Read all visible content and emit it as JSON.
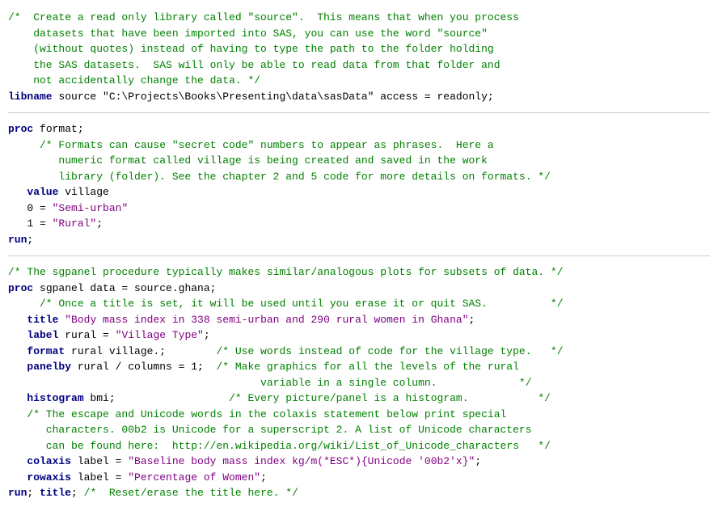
{
  "colors": {
    "comment": "#008000",
    "keyword": "#000080",
    "string": "#800080",
    "normal": "#000000",
    "red": "#cc0000"
  },
  "sections": [
    {
      "id": "libname-section",
      "lines": [
        {
          "type": "comment",
          "text": "/*  Create a read only library called \"source\".  This means that when you process"
        },
        {
          "type": "comment",
          "text": "    datasets that have been imported into SAS, you can use the word \"source\""
        },
        {
          "type": "comment",
          "text": "    (without quotes) instead of having to type the path to the folder holding"
        },
        {
          "type": "comment",
          "text": "    the SAS datasets.  SAS will only be able to read data from that folder and"
        },
        {
          "type": "comment",
          "text": "    not accidentally change the data. */"
        },
        {
          "type": "mixed",
          "parts": [
            {
              "style": "keyword",
              "text": "libname"
            },
            {
              "style": "normal",
              "text": " source \"C:\\Projects\\Books\\Presenting\\data\\sasData\" access = readonly;"
            }
          ]
        }
      ]
    },
    {
      "id": "format-section",
      "lines": [
        {
          "type": "mixed",
          "parts": [
            {
              "style": "keyword",
              "text": "proc"
            },
            {
              "style": "normal",
              "text": " format;"
            }
          ]
        },
        {
          "type": "comment",
          "text": "     /* Formats can cause \"secret code\" numbers to appear as phrases.  Here a"
        },
        {
          "type": "comment",
          "text": "        numeric format called village is being created and saved in the work"
        },
        {
          "type": "comment",
          "text": "        library (folder). See the chapter 2 and 5 code for more details on formats. */"
        },
        {
          "type": "mixed",
          "parts": [
            {
              "style": "normal",
              "text": "   "
            },
            {
              "style": "keyword",
              "text": "value"
            },
            {
              "style": "normal",
              "text": " village"
            }
          ]
        },
        {
          "type": "mixed",
          "parts": [
            {
              "style": "normal",
              "text": "   0 = "
            },
            {
              "style": "string",
              "text": "\"Semi-urban\""
            }
          ]
        },
        {
          "type": "mixed",
          "parts": [
            {
              "style": "normal",
              "text": "   1 = "
            },
            {
              "style": "string",
              "text": "\"Rural\""
            },
            {
              "style": "normal",
              "text": ";"
            }
          ]
        },
        {
          "type": "mixed",
          "parts": [
            {
              "style": "keyword",
              "text": "run"
            },
            {
              "style": "normal",
              "text": ";"
            }
          ]
        }
      ]
    },
    {
      "id": "sgpanel-section",
      "lines": [
        {
          "type": "comment",
          "text": "/* The sgpanel procedure typically makes similar/analogous plots for subsets of data. */"
        },
        {
          "type": "mixed",
          "parts": [
            {
              "style": "keyword",
              "text": "proc"
            },
            {
              "style": "normal",
              "text": " sgpanel data = source.ghana;"
            }
          ]
        },
        {
          "type": "comment",
          "text": "     /* Once a title is set, it will be used until you erase it or quit SAS.          */"
        },
        {
          "type": "mixed",
          "parts": [
            {
              "style": "normal",
              "text": "   "
            },
            {
              "style": "keyword",
              "text": "title"
            },
            {
              "style": "normal",
              "text": " "
            },
            {
              "style": "string",
              "text": "\"Body mass index in 338 semi-urban and 290 rural women in Ghana\""
            },
            {
              "style": "normal",
              "text": ";"
            }
          ]
        },
        {
          "type": "mixed",
          "parts": [
            {
              "style": "normal",
              "text": "   "
            },
            {
              "style": "keyword",
              "text": "label"
            },
            {
              "style": "normal",
              "text": " rural = "
            },
            {
              "style": "string",
              "text": "\"Village Type\""
            },
            {
              "style": "normal",
              "text": ";"
            }
          ]
        },
        {
          "type": "mixed",
          "parts": [
            {
              "style": "normal",
              "text": "   "
            },
            {
              "style": "keyword",
              "text": "format"
            },
            {
              "style": "normal",
              "text": " rural village.;        "
            },
            {
              "style": "comment",
              "text": "/* Use words instead of code for the village type.   */"
            }
          ]
        },
        {
          "type": "mixed",
          "parts": [
            {
              "style": "normal",
              "text": "   "
            },
            {
              "style": "keyword",
              "text": "panelby"
            },
            {
              "style": "normal",
              "text": " rural / columns = 1;  "
            },
            {
              "style": "comment",
              "text": "/* Make graphics for all the levels of the rural"
            }
          ]
        },
        {
          "type": "comment",
          "text": "                                        variable in a single column.             */"
        },
        {
          "type": "mixed",
          "parts": [
            {
              "style": "normal",
              "text": "   "
            },
            {
              "style": "keyword",
              "text": "histogram"
            },
            {
              "style": "normal",
              "text": " bmi;                  "
            },
            {
              "style": "comment",
              "text": "/* Every picture/panel is a histogram.           */"
            }
          ]
        },
        {
          "type": "comment",
          "text": "   /* The escape and Unicode words in the colaxis statement below print special"
        },
        {
          "type": "comment",
          "text": "      characters. 00b2 is Unicode for a superscript 2. A list of Unicode characters"
        },
        {
          "type": "mixed",
          "parts": [
            {
              "style": "comment",
              "text": "      can be found here:  http://en.wikipedia.org/wiki/List_of_Unicode_characters   */"
            }
          ]
        },
        {
          "type": "mixed",
          "parts": [
            {
              "style": "normal",
              "text": "   "
            },
            {
              "style": "keyword",
              "text": "colaxis"
            },
            {
              "style": "normal",
              "text": " label = "
            },
            {
              "style": "string",
              "text": "\"Baseline body mass index kg/m(*ESC*){Unicode '00b2'x}\""
            },
            {
              "style": "normal",
              "text": ";"
            }
          ]
        },
        {
          "type": "mixed",
          "parts": [
            {
              "style": "normal",
              "text": "   "
            },
            {
              "style": "keyword",
              "text": "rowaxis"
            },
            {
              "style": "normal",
              "text": " label = "
            },
            {
              "style": "string",
              "text": "\"Percentage of Women\""
            },
            {
              "style": "normal",
              "text": ";"
            }
          ]
        },
        {
          "type": "mixed",
          "parts": [
            {
              "style": "keyword",
              "text": "run"
            },
            {
              "style": "normal",
              "text": "; "
            },
            {
              "style": "keyword",
              "text": "title"
            },
            {
              "style": "normal",
              "text": "; "
            },
            {
              "style": "comment",
              "text": "/*  Reset/erase the title here. */"
            }
          ]
        }
      ]
    }
  ]
}
